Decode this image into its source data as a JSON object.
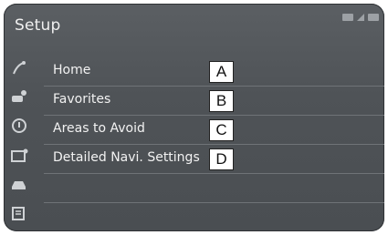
{
  "title": "Setup",
  "menu": {
    "items": [
      {
        "label": "Home",
        "marker": "A"
      },
      {
        "label": "Favorites",
        "marker": "B"
      },
      {
        "label": "Areas to Avoid",
        "marker": "C"
      },
      {
        "label": "Detailed Navi. Settings",
        "marker": "D"
      }
    ]
  },
  "sidebar_icons": [
    "navigation-icon",
    "car-pin-icon",
    "audio-icon",
    "phone-settings-icon",
    "vehicle-icon",
    "info-icon"
  ],
  "colors": {
    "screen_bg": "#505458",
    "text": "#f2f2f2",
    "callout_bg": "#ffffff"
  }
}
